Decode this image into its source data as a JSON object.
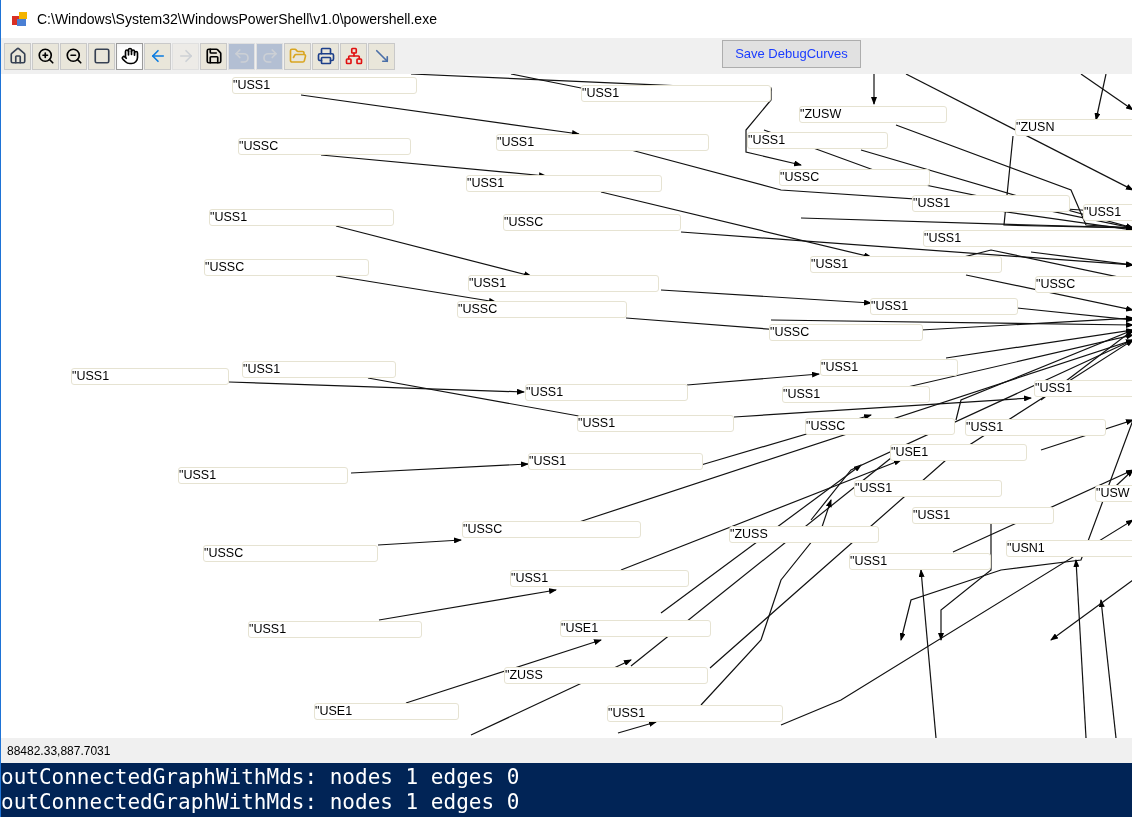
{
  "window": {
    "title": "C:\\Windows\\System32\\WindowsPowerShell\\v1.0\\powershell.exe"
  },
  "toolbar": [
    {
      "kind": "home",
      "selected": false,
      "disabled": false
    },
    {
      "kind": "zoom-in",
      "selected": false,
      "disabled": false
    },
    {
      "kind": "zoom-out",
      "selected": false,
      "disabled": false
    },
    {
      "kind": "window-zoom",
      "selected": false,
      "disabled": false
    },
    {
      "kind": "pan",
      "selected": true,
      "disabled": false
    },
    {
      "kind": "back",
      "selected": false,
      "disabled": false
    },
    {
      "kind": "forward",
      "selected": false,
      "disabled": true
    },
    {
      "kind": "save",
      "selected": false,
      "disabled": false
    },
    {
      "kind": "undo",
      "selected": false,
      "disabled": true
    },
    {
      "kind": "redo",
      "selected": false,
      "disabled": true
    },
    {
      "kind": "open",
      "selected": false,
      "disabled": false
    },
    {
      "kind": "print",
      "selected": false,
      "disabled": false
    },
    {
      "kind": "layout",
      "selected": false,
      "disabled": false
    },
    {
      "kind": "edge",
      "selected": false,
      "disabled": false
    }
  ],
  "save_button": "Save DebugCurves",
  "graph": {
    "nodes": [
      "\"USS1",
      "\"USS1",
      "\"ZUSW",
      "\"ZUSN",
      "\"USS1",
      "\"USSC",
      "\"USS1",
      "\"USSC",
      "\"USS1",
      "\"USS1",
      "\"USS1",
      "\"USS1",
      "\"USSC",
      "\"USS1",
      "\"USS1",
      "\"USSC",
      "\"USSC",
      "\"USS1",
      "\"USS1",
      "\"USSC",
      "\"USSC",
      "\"USS1",
      "\"USS1",
      "\"USS1",
      "\"USS1",
      "\"USS1",
      "\"USS1",
      "\"USS1",
      "\"USSC",
      "\"USS1",
      "\"USE1",
      "\"USS1",
      "\"USS1",
      "\"USS1",
      "\"USW",
      "\"USS1",
      "\"USSC",
      "\"ZUSS",
      "\"USSC",
      "\"USN1",
      "\"USS1",
      "\"USS1",
      "\"USS1",
      "\"USE1",
      "\"ZUSS",
      "\"USE1",
      "\"USS1"
    ]
  },
  "status_bar": "88482.33,887.7031",
  "console": [
    "outConnectedGraphWithMds: nodes 1 edges 0",
    "outConnectedGraphWithMds: nodes 1 edges 0"
  ]
}
